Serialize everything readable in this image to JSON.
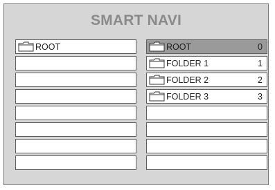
{
  "title": "SMART NAVI",
  "left_panel": {
    "items": [
      {
        "label": "ROOT",
        "icon": "folder-icon"
      },
      {
        "label": ""
      },
      {
        "label": ""
      },
      {
        "label": ""
      },
      {
        "label": ""
      },
      {
        "label": ""
      },
      {
        "label": ""
      },
      {
        "label": ""
      }
    ]
  },
  "right_panel": {
    "items": [
      {
        "label": "ROOT",
        "count": "0",
        "icon": "folder-icon",
        "selected": true
      },
      {
        "label": "FOLDER 1",
        "count": "1",
        "icon": "folder-icon"
      },
      {
        "label": "FOLDER 2",
        "count": "2",
        "icon": "folder-icon"
      },
      {
        "label": "FOLDER 3",
        "count": "3",
        "icon": "folder-icon"
      },
      {
        "label": ""
      },
      {
        "label": ""
      },
      {
        "label": ""
      },
      {
        "label": ""
      }
    ]
  },
  "colors": {
    "background": "#d6d6d6",
    "title": "#8a8a8a",
    "row": "#ffffff",
    "row_selected": "#9a9a9a",
    "border": "#5f5f5f"
  }
}
